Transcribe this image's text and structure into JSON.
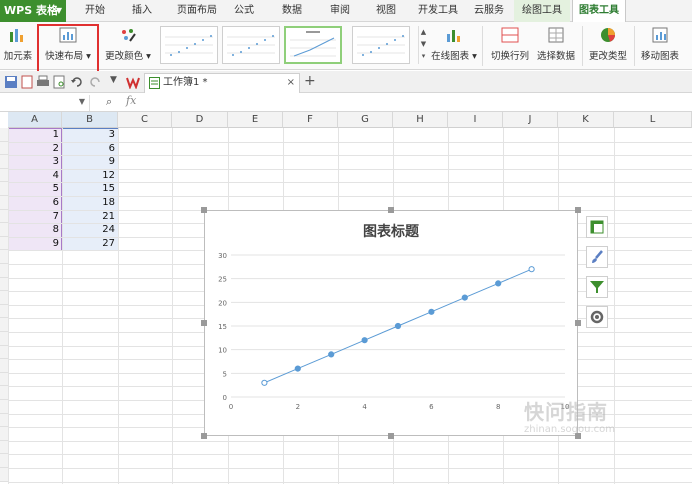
{
  "app": {
    "name": "WPS 表格"
  },
  "menu": {
    "tabs": [
      "开始",
      "插入",
      "页面布局",
      "公式",
      "数据",
      "审阅",
      "视图",
      "开发工具",
      "云服务",
      "绘图工具",
      "图表工具"
    ],
    "active": "图表工具"
  },
  "ribbon": {
    "add_element": "加元素",
    "quick_layout": "快速布局",
    "change_color": "更改颜色",
    "online_chart": "在线图表",
    "switch_row_col": "切换行列",
    "select_data": "选择数据",
    "change_type": "更改类型",
    "move_chart": "移动图表"
  },
  "doc": {
    "tab_name": "工作簿1 *",
    "close": "×",
    "new": "+"
  },
  "formula": {
    "fx": "fx"
  },
  "sheet": {
    "columns": [
      "A",
      "B",
      "C",
      "D",
      "E",
      "F",
      "G",
      "H",
      "I",
      "J",
      "K",
      "L"
    ],
    "rows": [
      [
        "1",
        "3"
      ],
      [
        "2",
        "6"
      ],
      [
        "3",
        "9"
      ],
      [
        "4",
        "12"
      ],
      [
        "5",
        "15"
      ],
      [
        "6",
        "18"
      ],
      [
        "7",
        "21"
      ],
      [
        "8",
        "24"
      ],
      [
        "9",
        "27"
      ]
    ]
  },
  "chart_data": {
    "type": "scatter",
    "title": "图表标题",
    "x": [
      1,
      2,
      3,
      4,
      5,
      6,
      7,
      8,
      9
    ],
    "y": [
      3,
      6,
      9,
      12,
      15,
      18,
      21,
      24,
      27
    ],
    "xlim": [
      0,
      10
    ],
    "ylim": [
      0,
      30
    ],
    "xticks": [
      0,
      2,
      4,
      6,
      8,
      10
    ],
    "yticks": [
      0,
      5,
      10,
      15,
      20,
      25,
      30
    ],
    "line": true,
    "grid": "horizontal",
    "colors": {
      "series": "#5b9bd5"
    }
  },
  "watermark": {
    "text": "快问指南",
    "sub": "zhinan.sogou.com"
  }
}
